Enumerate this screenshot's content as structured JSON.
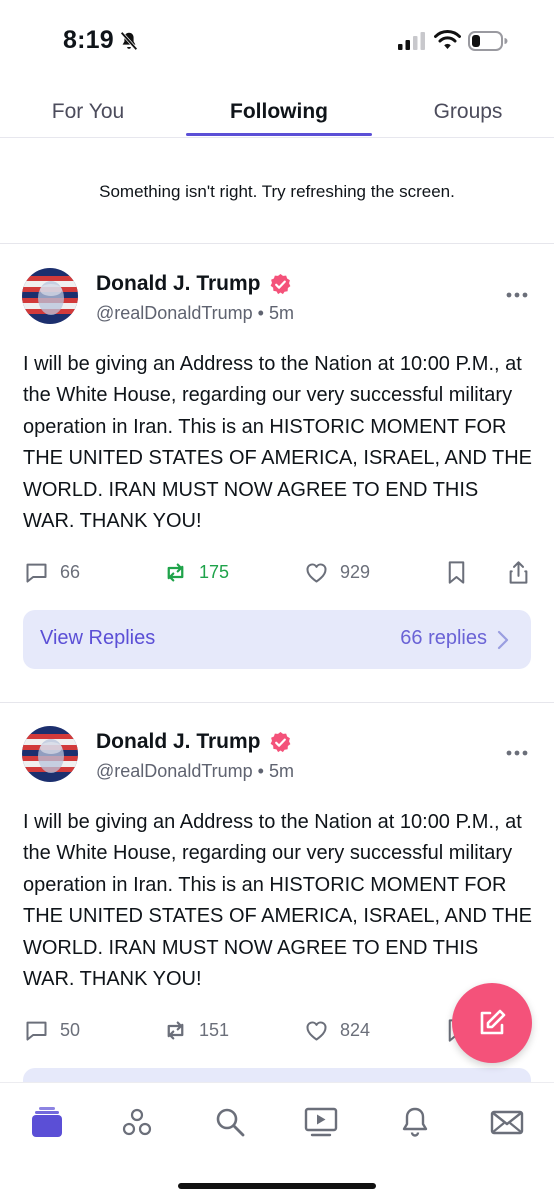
{
  "status_bar": {
    "time": "8:19"
  },
  "tabs": [
    {
      "label": "For You"
    },
    {
      "label": "Following"
    },
    {
      "label": "Groups"
    }
  ],
  "error_message": "Something isn't right. Try refreshing the screen.",
  "posts": [
    {
      "author": "Donald J. Trump",
      "handle": "@realDonaldTrump • 5m",
      "text": "I will be giving an Address to the Nation at 10:00 P.M., at the White House, regarding our very successful military operation in Iran. This is an HISTORIC MOMENT FOR THE UNITED STATES OF AMERICA, ISRAEL, AND THE WORLD. IRAN MUST NOW AGREE TO END THIS WAR. THANK YOU!",
      "replies": "66",
      "reposts": "175",
      "likes": "929",
      "view_replies_label": "View Replies",
      "replies_count_label": "66 replies"
    },
    {
      "author": "Donald J. Trump",
      "handle": "@realDonaldTrump • 5m",
      "text": "I will be giving an Address to the Nation at 10:00 P.M., at the White House, regarding our very successful military operation in Iran. This is an HISTORIC MOMENT FOR THE UNITED STATES OF AMERICA, ISRAEL, AND THE WORLD. IRAN MUST NOW AGREE TO END THIS WAR. THANK YOU!",
      "replies": "50",
      "reposts": "151",
      "likes": "824"
    }
  ],
  "colors": {
    "accent": "#5b4fd6",
    "verified": "#f4527a",
    "repost_active": "#1fa34a",
    "fab": "#f4527a",
    "view_replies_bg": "#e6e9fa"
  },
  "icons": [
    "bell-off-icon",
    "signal-icon",
    "wifi-icon",
    "battery-icon",
    "verified-icon",
    "more-icon",
    "reply-icon",
    "repost-icon",
    "like-icon",
    "bookmark-icon",
    "share-icon",
    "chevron-right-icon",
    "compose-icon",
    "feed-icon",
    "groups-icon",
    "search-icon",
    "video-icon",
    "notifications-icon",
    "messages-icon"
  ]
}
